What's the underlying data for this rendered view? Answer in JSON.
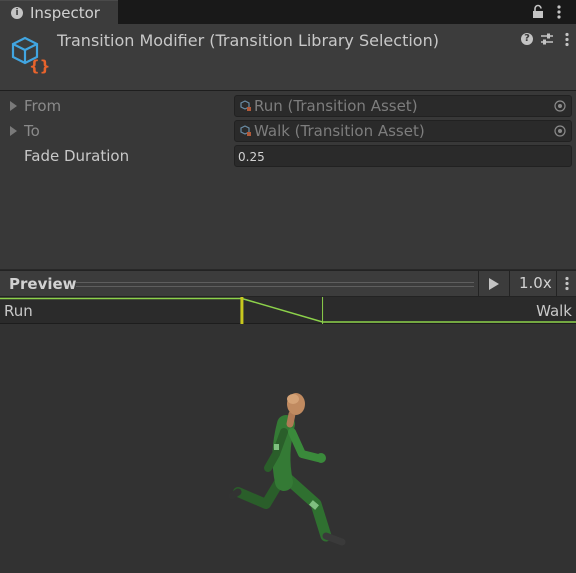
{
  "window": {
    "tab_label": "Inspector",
    "tab_icon": "info-icon"
  },
  "header": {
    "title": "Transition Modifier (Transition Library Selection)",
    "asset_icon": "script-asset-icon",
    "help_glyph": "?"
  },
  "properties": {
    "from": {
      "label": "From",
      "value": "Run (Transition Asset)"
    },
    "to": {
      "label": "To",
      "value": "Walk (Transition Asset)"
    },
    "fade_duration": {
      "label": "Fade Duration",
      "value": "0.25"
    }
  },
  "preview": {
    "title": "Preview",
    "speed": "1.0x",
    "from_state": "Run",
    "to_state": "Walk",
    "transition_start_fraction": 0.42,
    "transition_end_fraction": 0.56
  },
  "colors": {
    "accent_green": "#8cd14a",
    "marker_yellow": "#c8c81e",
    "asset_icon_blue": "#41a5e1",
    "asset_icon_orange": "#e8632c"
  }
}
